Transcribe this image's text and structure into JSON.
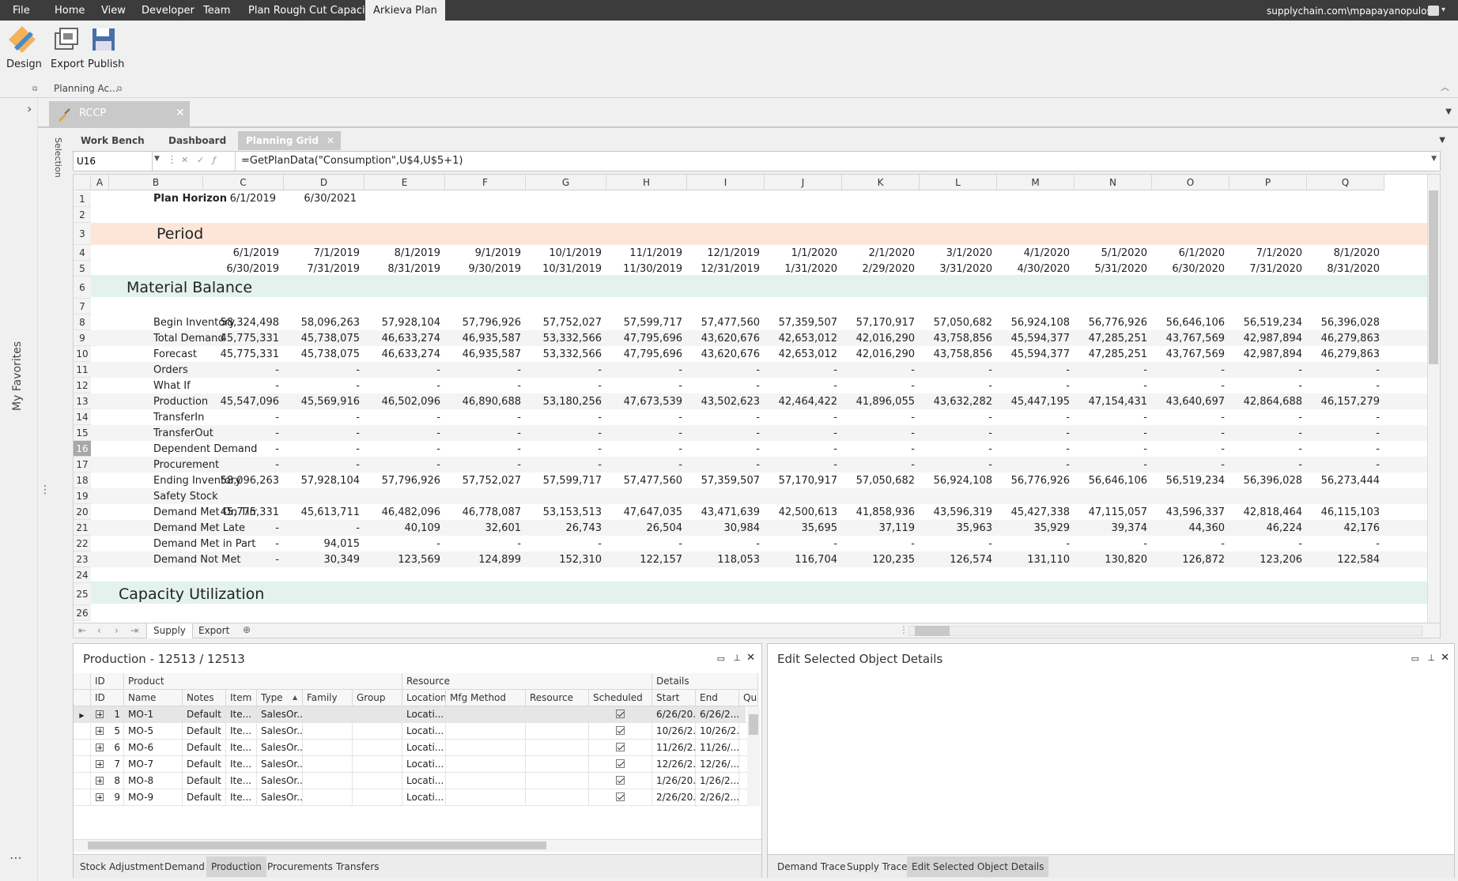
{
  "menubar": {
    "items": [
      "File",
      "Home",
      "View",
      "Developer",
      "Team",
      "Plan Rough Cut Capacity",
      "Arkieva Plan"
    ],
    "account": "supplychain.com\\mpapayanopulos"
  },
  "ribbon": {
    "buttons": [
      "Design",
      "Export",
      "Publish"
    ],
    "groups": [
      "Planning Ac..."
    ]
  },
  "leftrail": {
    "my_favorites": "My Favorites",
    "selection": "Selection"
  },
  "doc_tab": {
    "label": "RCCP"
  },
  "sheet_tabs": [
    "Work Bench",
    "Dashboard",
    "Planning Grid"
  ],
  "formula": {
    "cell_ref": "U16",
    "text": "=GetPlanData(\"Consumption\",U$4,U$5+1)"
  },
  "grid": {
    "columns": [
      "A",
      "B",
      "C",
      "D",
      "E",
      "F",
      "G",
      "H",
      "I",
      "J",
      "K",
      "L",
      "M",
      "N",
      "O",
      "P",
      "Q"
    ],
    "rows": [
      "1",
      "2",
      "3",
      "4",
      "5",
      "6",
      "7",
      "8",
      "9",
      "10",
      "11",
      "12",
      "13",
      "14",
      "15",
      "16",
      "17",
      "18",
      "19",
      "20",
      "21",
      "22",
      "23",
      "24",
      "25",
      "26"
    ],
    "plan_horizon": {
      "label": "Plan Horizon",
      "start": "6/1/2019",
      "end": "6/30/2021"
    },
    "period_title": "Period",
    "material_balance_title": "Material Balance",
    "capacity_title": "Capacity Utilization",
    "period_starts": [
      "6/1/2019",
      "7/1/2019",
      "8/1/2019",
      "9/1/2019",
      "10/1/2019",
      "11/1/2019",
      "12/1/2019",
      "1/1/2020",
      "2/1/2020",
      "3/1/2020",
      "4/1/2020",
      "5/1/2020",
      "6/1/2020",
      "7/1/2020",
      "8/1/2020"
    ],
    "period_ends": [
      "6/30/2019",
      "7/31/2019",
      "8/31/2019",
      "9/30/2019",
      "10/31/2019",
      "11/30/2019",
      "12/31/2019",
      "1/31/2020",
      "2/29/2020",
      "3/31/2020",
      "4/30/2020",
      "5/31/2020",
      "6/30/2020",
      "7/31/2020",
      "8/31/2020"
    ],
    "data_rows": [
      {
        "label": "Begin Inventory",
        "values": [
          "58,324,498",
          "58,096,263",
          "57,928,104",
          "57,796,926",
          "57,752,027",
          "57,599,717",
          "57,477,560",
          "57,359,507",
          "57,170,917",
          "57,050,682",
          "56,924,108",
          "56,776,926",
          "56,646,106",
          "56,519,234",
          "56,396,028"
        ]
      },
      {
        "label": "Total Demand",
        "values": [
          "45,775,331",
          "45,738,075",
          "46,633,274",
          "46,935,587",
          "53,332,566",
          "47,795,696",
          "43,620,676",
          "42,653,012",
          "42,016,290",
          "43,758,856",
          "45,594,377",
          "47,285,251",
          "43,767,569",
          "42,987,894",
          "46,279,863"
        ]
      },
      {
        "label": "Forecast",
        "values": [
          "45,775,331",
          "45,738,075",
          "46,633,274",
          "46,935,587",
          "53,332,566",
          "47,795,696",
          "43,620,676",
          "42,653,012",
          "42,016,290",
          "43,758,856",
          "45,594,377",
          "47,285,251",
          "43,767,569",
          "42,987,894",
          "46,279,863"
        ]
      },
      {
        "label": "Orders",
        "values": [
          "-",
          "-",
          "-",
          "-",
          "-",
          "-",
          "-",
          "-",
          "-",
          "-",
          "-",
          "-",
          "-",
          "-",
          "-"
        ]
      },
      {
        "label": "What If",
        "values": [
          "-",
          "-",
          "-",
          "-",
          "-",
          "-",
          "-",
          "-",
          "-",
          "-",
          "-",
          "-",
          "-",
          "-",
          "-"
        ]
      },
      {
        "label": "Production",
        "values": [
          "45,547,096",
          "45,569,916",
          "46,502,096",
          "46,890,688",
          "53,180,256",
          "47,673,539",
          "43,502,623",
          "42,464,422",
          "41,896,055",
          "43,632,282",
          "45,447,195",
          "47,154,431",
          "43,640,697",
          "42,864,688",
          "46,157,279"
        ]
      },
      {
        "label": "TransferIn",
        "values": [
          "-",
          "-",
          "-",
          "-",
          "-",
          "-",
          "-",
          "-",
          "-",
          "-",
          "-",
          "-",
          "-",
          "-",
          "-"
        ]
      },
      {
        "label": "TransferOut",
        "values": [
          "-",
          "-",
          "-",
          "-",
          "-",
          "-",
          "-",
          "-",
          "-",
          "-",
          "-",
          "-",
          "-",
          "-",
          "-"
        ]
      },
      {
        "label": "Dependent Demand",
        "values": [
          "-",
          "-",
          "-",
          "-",
          "-",
          "-",
          "-",
          "-",
          "-",
          "-",
          "-",
          "-",
          "-",
          "-",
          "-"
        ]
      },
      {
        "label": "Procurement",
        "values": [
          "-",
          "-",
          "-",
          "-",
          "-",
          "-",
          "-",
          "-",
          "-",
          "-",
          "-",
          "-",
          "-",
          "-",
          "-"
        ]
      },
      {
        "label": "Ending Inventory",
        "values": [
          "58,096,263",
          "57,928,104",
          "57,796,926",
          "57,752,027",
          "57,599,717",
          "57,477,560",
          "57,359,507",
          "57,170,917",
          "57,050,682",
          "56,924,108",
          "56,776,926",
          "56,646,106",
          "56,519,234",
          "56,396,028",
          "56,273,444"
        ]
      },
      {
        "label": "Safety Stock",
        "values": [
          "",
          "",
          "",
          "",
          "",
          "",
          "",
          "",
          "",
          "",
          "",
          "",
          "",
          "",
          ""
        ]
      },
      {
        "label": "Demand Met On Time",
        "values": [
          "45,775,331",
          "45,613,711",
          "46,482,096",
          "46,778,087",
          "53,153,513",
          "47,647,035",
          "43,471,639",
          "42,500,613",
          "41,858,936",
          "43,596,319",
          "45,427,338",
          "47,115,057",
          "43,596,337",
          "42,818,464",
          "46,115,103"
        ]
      },
      {
        "label": "Demand Met Late",
        "values": [
          "-",
          "-",
          "40,109",
          "32,601",
          "26,743",
          "26,504",
          "30,984",
          "35,695",
          "37,119",
          "35,963",
          "35,929",
          "39,374",
          "44,360",
          "46,224",
          "42,176"
        ]
      },
      {
        "label": "Demand Met in Part",
        "values": [
          "-",
          "94,015",
          "-",
          "-",
          "-",
          "-",
          "-",
          "-",
          "-",
          "-",
          "-",
          "-",
          "-",
          "-",
          "-"
        ]
      },
      {
        "label": "Demand Not Met",
        "values": [
          "-",
          "30,349",
          "123,569",
          "124,899",
          "152,310",
          "122,157",
          "118,053",
          "116,704",
          "120,235",
          "126,574",
          "131,110",
          "130,820",
          "126,872",
          "123,206",
          "122,584"
        ]
      }
    ]
  },
  "sheets": [
    "Supply",
    "Export"
  ],
  "production_panel": {
    "title": "Production - 12513 / 12513",
    "band_headers": [
      "ID",
      "Product",
      "Resource",
      "Details"
    ],
    "columns": [
      "ID",
      "Name",
      "Notes",
      "Item",
      "Type",
      "Family",
      "Group",
      "Location",
      "Mfg Method",
      "Resource",
      "Scheduled",
      "Start",
      "End",
      "Quar"
    ],
    "rows": [
      {
        "id": "1",
        "name": "MO-1",
        "notes": "Default ...",
        "item": "Ite...",
        "type": "SalesOr...",
        "location": "Locati...",
        "start": "6/26/20...",
        "end": "6/26/2..."
      },
      {
        "id": "5",
        "name": "MO-5",
        "notes": "Default ...",
        "item": "Ite...",
        "type": "SalesOr...",
        "location": "Locati...",
        "start": "10/26/2...",
        "end": "10/26/2..."
      },
      {
        "id": "6",
        "name": "MO-6",
        "notes": "Default ...",
        "item": "Ite...",
        "type": "SalesOr...",
        "location": "Locati...",
        "start": "11/26/2...",
        "end": "11/26/..."
      },
      {
        "id": "7",
        "name": "MO-7",
        "notes": "Default ...",
        "item": "Ite...",
        "type": "SalesOr...",
        "location": "Locati...",
        "start": "12/26/2...",
        "end": "12/26/..."
      },
      {
        "id": "8",
        "name": "MO-8",
        "notes": "Default ...",
        "item": "Ite...",
        "type": "SalesOr...",
        "location": "Locati...",
        "start": "1/26/20...",
        "end": "1/26/2..."
      },
      {
        "id": "9",
        "name": "MO-9",
        "notes": "Default ...",
        "item": "Ite...",
        "type": "SalesOr...",
        "location": "Locati...",
        "start": "2/26/20...",
        "end": "2/26/2..."
      }
    ],
    "tabs": [
      "Stock Adjustment",
      "Demand",
      "Production",
      "Procurements",
      "Transfers"
    ]
  },
  "edit_panel": {
    "title": "Edit  Selected Object Details",
    "tabs": [
      "Demand Trace",
      "Supply Trace",
      "Edit  Selected Object Details"
    ]
  },
  "colors": {
    "menubar": "#3c3c3c",
    "period_band": "#fde6d8",
    "section_band": "#e3f2ea",
    "accent": "#c9c9c9"
  }
}
